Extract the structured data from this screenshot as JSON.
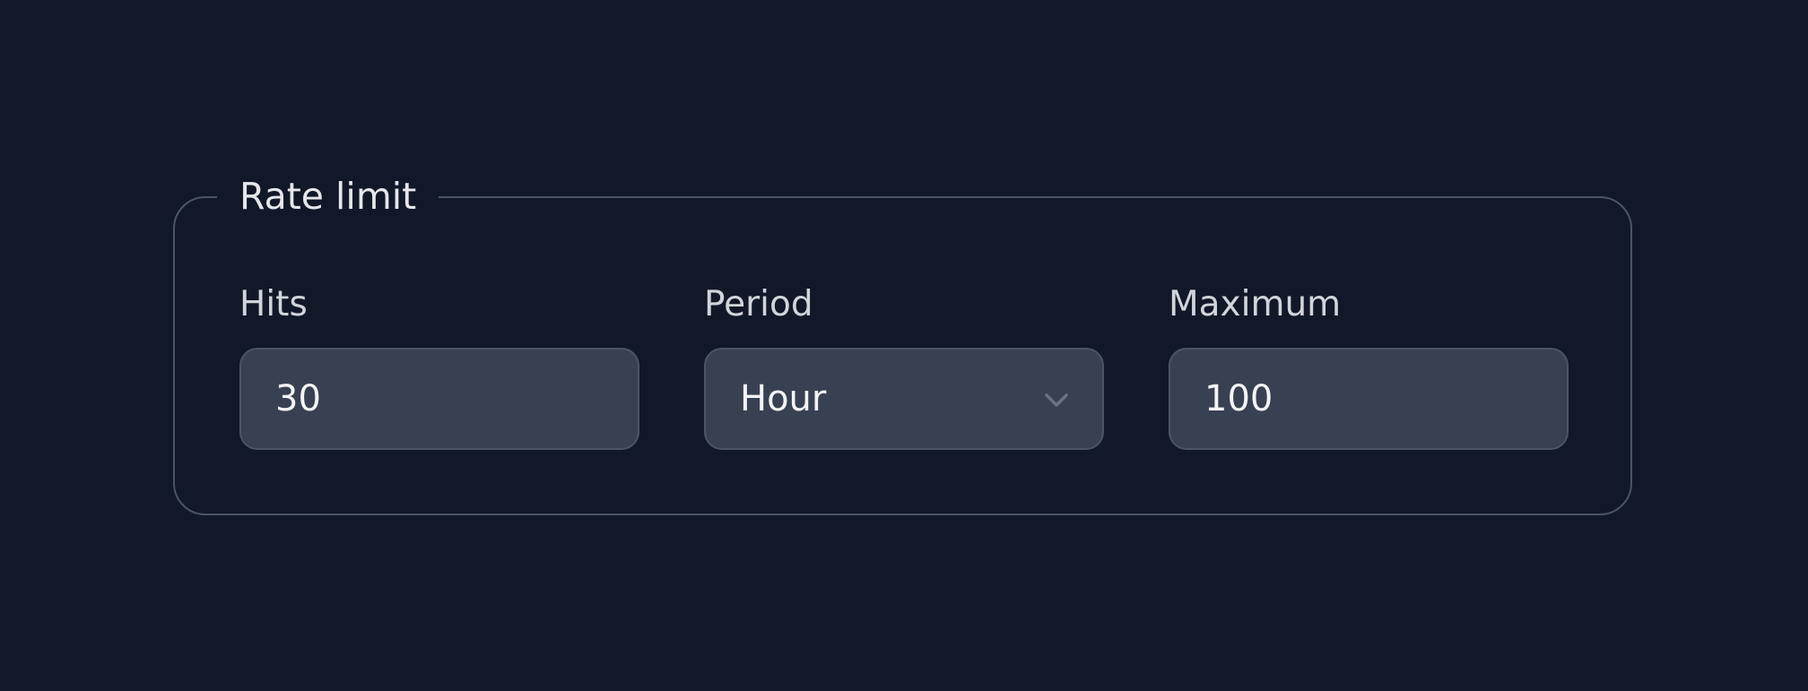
{
  "fieldset": {
    "legend": "Rate limit"
  },
  "fields": {
    "hits": {
      "label": "Hits",
      "value": "30"
    },
    "period": {
      "label": "Period",
      "selected": "Hour"
    },
    "maximum": {
      "label": "Maximum",
      "value": "100"
    }
  },
  "icons": {
    "period_dropdown": "chevron-down-icon"
  },
  "colors": {
    "background": "#111827",
    "border": "#4b5563",
    "input_bg": "#374151",
    "text": "#f3f4f6"
  }
}
